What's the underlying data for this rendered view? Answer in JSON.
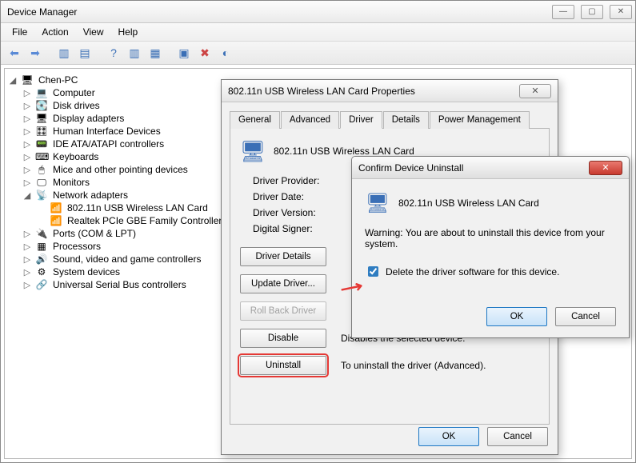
{
  "window": {
    "title": "Device Manager",
    "menus": [
      "File",
      "Action",
      "View",
      "Help"
    ]
  },
  "tree": {
    "root": "Chen-PC",
    "items": [
      "Computer",
      "Disk drives",
      "Display adapters",
      "Human Interface Devices",
      "IDE ATA/ATAPI controllers",
      "Keyboards",
      "Mice and other pointing devices",
      "Monitors",
      "Network adapters",
      "Ports (COM & LPT)",
      "Processors",
      "Sound, video and game controllers",
      "System devices",
      "Universal Serial Bus controllers"
    ],
    "net_children": [
      "802.11n USB Wireless LAN Card",
      "Realtek PCIe GBE Family Controller"
    ]
  },
  "prop": {
    "title": "802.11n USB Wireless LAN Card Properties",
    "device": "802.11n USB Wireless LAN Card",
    "tabs": [
      "General",
      "Advanced",
      "Driver",
      "Details",
      "Power Management"
    ],
    "labels": {
      "provider": "Driver Provider:",
      "date": "Driver Date:",
      "version": "Driver Version:",
      "signer": "Digital Signer:"
    },
    "buttons": {
      "details": "Driver Details",
      "update": "Update Driver...",
      "rollback": "Roll Back Driver",
      "disable": "Disable",
      "uninstall": "Uninstall"
    },
    "desc": {
      "disable": "Disables the selected device.",
      "uninstall": "To uninstall the driver (Advanced)."
    },
    "footer": {
      "ok": "OK",
      "cancel": "Cancel"
    }
  },
  "confirm": {
    "title": "Confirm Device Uninstall",
    "device": "802.11n USB Wireless LAN Card",
    "warning": "Warning: You are about to uninstall this device from your system.",
    "checkbox": "Delete the driver software for this device.",
    "checked": true,
    "footer": {
      "ok": "OK",
      "cancel": "Cancel"
    }
  }
}
